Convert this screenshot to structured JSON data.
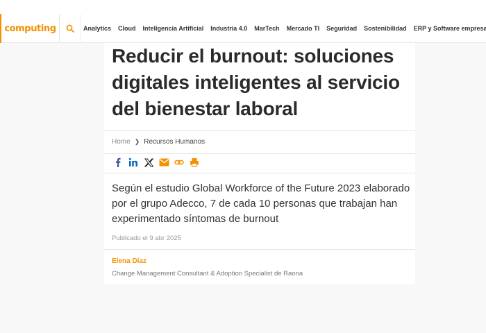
{
  "header": {
    "logo": "computing",
    "nav": [
      "Analytics",
      "Cloud",
      "Inteligencia Artificial",
      "Industria 4.0",
      "MarTech",
      "Mercado TI",
      "Seguridad",
      "Sostenibilidad",
      "ERP y Software empresarial"
    ]
  },
  "article": {
    "title": "Reducir el burnout: soluciones digitales inteligentes al servicio del bienestar laboral",
    "breadcrumb": {
      "home": "Home",
      "section": "Recursos Humanos"
    },
    "share_icons": [
      "facebook-icon",
      "linkedin-icon",
      "x-icon",
      "email-icon",
      "link-icon",
      "print-icon"
    ],
    "lead": "Según el estudio Global Workforce of the Future 2023 elaborado por el grupo Adecco, 7 de cada 10 personas que trabajan han experimentado síntomas de burnout",
    "published": "Publicado el 9 abr 2025",
    "author_name": "Elena Díaz",
    "author_role": "Change Management Consultant & Adoption Specialist de Raona"
  },
  "colors": {
    "accent": "#f39200",
    "facebook": "#3b5998",
    "linkedin": "#0a66c2"
  }
}
